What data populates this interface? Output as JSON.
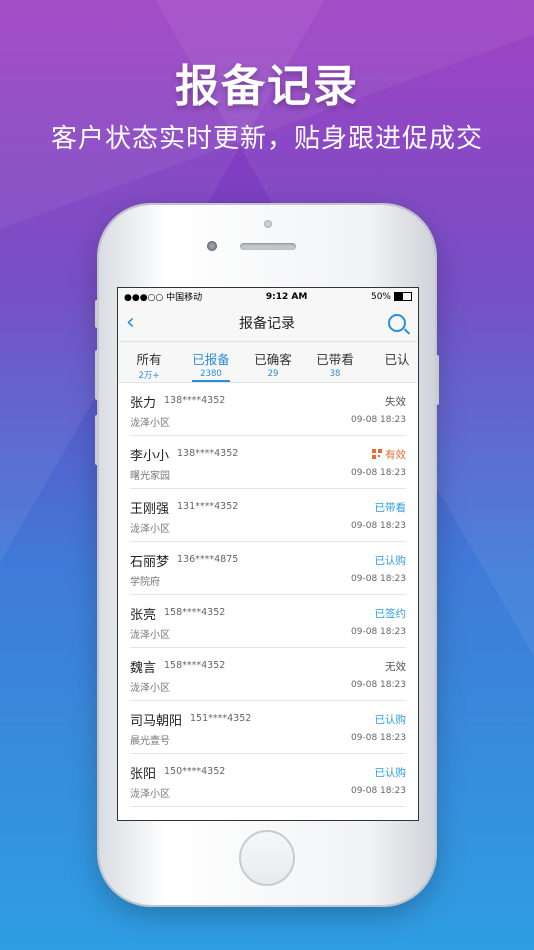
{
  "banner": {
    "title": "报备记录",
    "subtitle": "客户状态实时更新，贴身跟进促成交"
  },
  "status_bar": {
    "carrier": "●●●○○ 中国移动",
    "time": "9:12 AM",
    "battery": "50%"
  },
  "nav": {
    "back_icon": "chevron-left-icon",
    "title": "报备记录",
    "search_icon": "search-icon"
  },
  "tabs": [
    {
      "label": "所有",
      "count": "2万+"
    },
    {
      "label": "已报备",
      "count": "2380",
      "active": true
    },
    {
      "label": "已确客",
      "count": "29"
    },
    {
      "label": "已带看",
      "count": "38"
    },
    {
      "label": "已认",
      "count": ""
    }
  ],
  "records": [
    {
      "name": "张力",
      "phone": "138****4352",
      "address": "泷泽小区",
      "status": "失效",
      "time": "09-08 18:23"
    },
    {
      "name": "李小小",
      "phone": "138****4352",
      "address": "曙光家园",
      "status": "有效",
      "time": "09-08 18:23"
    },
    {
      "name": "王刚强",
      "phone": "131****4352",
      "address": "泷泽小区",
      "status": "已带看",
      "time": "09-08 18:23"
    },
    {
      "name": "石丽梦",
      "phone": "136****4875",
      "address": "学院府",
      "status": "已认购",
      "time": "09-08 18:23"
    },
    {
      "name": "张亮",
      "phone": "158****4352",
      "address": "泷泽小区",
      "status": "已签约",
      "time": "09-08 18:23"
    },
    {
      "name": "魏言",
      "phone": "158****4352",
      "address": "泷泽小区",
      "status": "无效",
      "time": "09-08 18:23"
    },
    {
      "name": "司马朝阳",
      "phone": "151****4352",
      "address": "晨光壹号",
      "status": "已认购",
      "time": "09-08 18:23"
    },
    {
      "name": "张阳",
      "phone": "150****4352",
      "address": "泷泽小区",
      "status": "已认购",
      "time": "09-08 18:23"
    }
  ],
  "colors": {
    "accent": "#2a8fd8",
    "status_blue": "#2a9ee3",
    "status_orange": "#ee6a2c",
    "status_gray": "#555555"
  }
}
